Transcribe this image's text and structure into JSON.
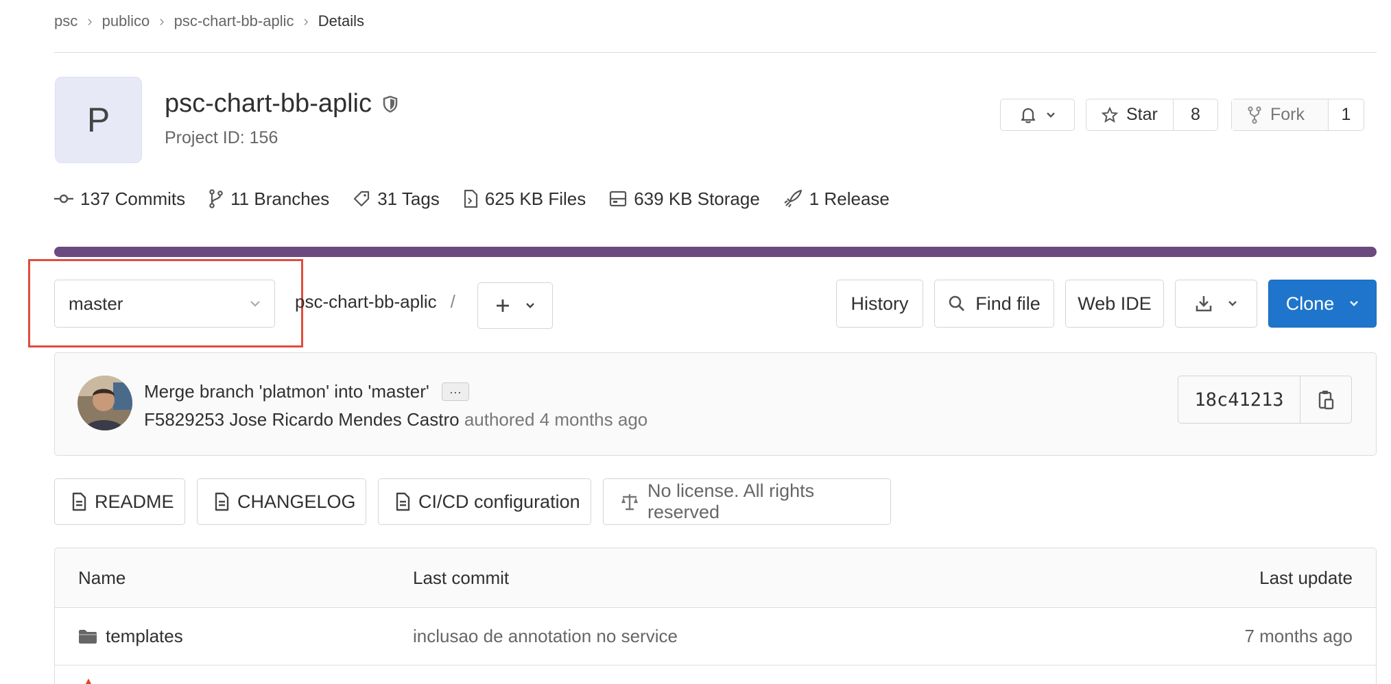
{
  "breadcrumb": {
    "items": [
      "psc",
      "publico",
      "psc-chart-bb-aplic"
    ],
    "current": "Details"
  },
  "project": {
    "avatar_letter": "P",
    "name": "psc-chart-bb-aplic",
    "id_label": "Project ID: 156"
  },
  "header_actions": {
    "star_label": "Star",
    "star_count": "8",
    "fork_label": "Fork",
    "fork_count": "1"
  },
  "stats": [
    {
      "icon": "commit-icon",
      "label": "137 Commits"
    },
    {
      "icon": "branch-icon",
      "label": "11 Branches"
    },
    {
      "icon": "tag-icon",
      "label": "31 Tags"
    },
    {
      "icon": "file-icon",
      "label": "625 KB Files"
    },
    {
      "icon": "storage-icon",
      "label": "639 KB Storage"
    },
    {
      "icon": "rocket-icon",
      "label": "1 Release"
    }
  ],
  "toolbar": {
    "branch": "master",
    "path_root": "psc-chart-bb-aplic",
    "path_sep": "/",
    "history": "History",
    "find_file": "Find file",
    "web_ide": "Web IDE",
    "clone": "Clone"
  },
  "commit": {
    "message": "Merge branch 'platmon' into 'master'",
    "ellipsis": "···",
    "author": "F5829253 Jose Ricardo Mendes Castro",
    "authored": "authored 4 months ago",
    "sha": "18c41213"
  },
  "shortcuts": {
    "readme": "README",
    "changelog": "CHANGELOG",
    "cicd": "CI/CD configuration",
    "license": "No license. All rights reserved"
  },
  "table": {
    "headers": {
      "name": "Name",
      "last_commit": "Last commit",
      "last_update": "Last update"
    },
    "rows": [
      {
        "name": "templates",
        "last_commit": "inclusao de annotation no service",
        "last_update": "7 months ago"
      }
    ]
  },
  "colors": {
    "accent": "#1f75cb",
    "bar": "#6b4a7f",
    "highlight": "#e04c3c"
  }
}
